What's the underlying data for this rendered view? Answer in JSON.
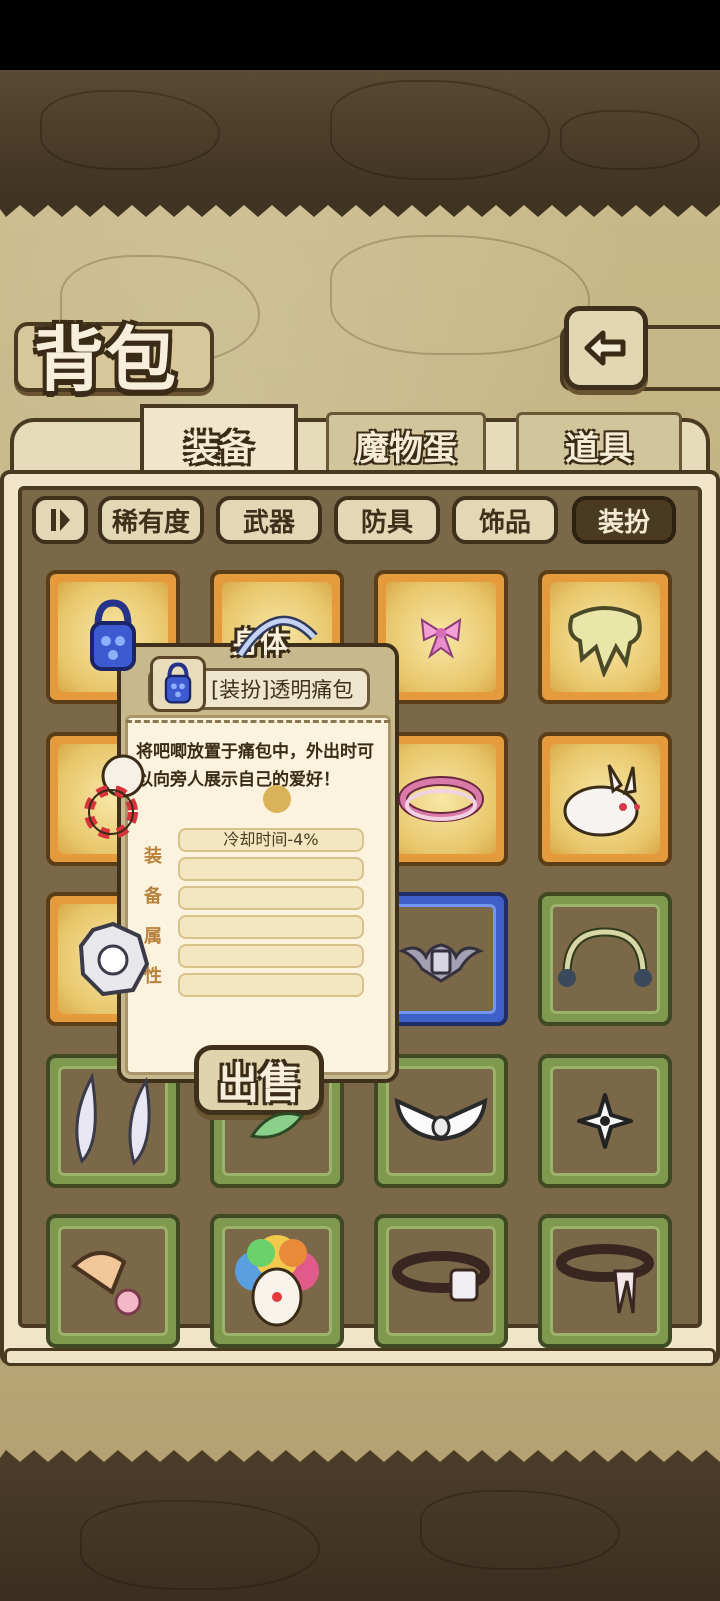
{
  "header": {
    "title": "背包",
    "back_icon": "return-arrow-icon"
  },
  "tabs": [
    {
      "label": "装备",
      "active": true
    },
    {
      "label": "魔物蛋",
      "active": false
    },
    {
      "label": "道具",
      "active": false
    }
  ],
  "filters": {
    "sort_icon": "sort-toggle-icon",
    "items": [
      "稀有度",
      "武器",
      "防具",
      "饰品",
      "装扮"
    ],
    "selected": "装扮"
  },
  "slots": [
    {
      "rarity": "gold",
      "icon": "blue-bag-icon"
    },
    {
      "rarity": "gold",
      "icon": "headband-icon"
    },
    {
      "rarity": "gold",
      "icon": "pink-bow-icon"
    },
    {
      "rarity": "gold",
      "icon": "yellow-slime-icon"
    },
    {
      "rarity": "gold",
      "icon": "candy-cane-icon"
    },
    {
      "rarity": "gold",
      "icon": "unknown-icon"
    },
    {
      "rarity": "gold",
      "icon": "bracelet-icon"
    },
    {
      "rarity": "gold",
      "icon": "white-rabbit-icon"
    },
    {
      "rarity": "gold",
      "icon": "bagua-mirror-icon"
    },
    {
      "rarity": "blue",
      "icon": "unknown-icon"
    },
    {
      "rarity": "blue",
      "icon": "bat-wing-emblem-icon"
    },
    {
      "rarity": "green",
      "icon": "headphones-icon"
    },
    {
      "rarity": "green",
      "icon": "feather-pair-icon"
    },
    {
      "rarity": "green",
      "icon": "green-leaf-icon"
    },
    {
      "rarity": "green",
      "icon": "white-bow-icon"
    },
    {
      "rarity": "green",
      "icon": "shuriken-icon"
    },
    {
      "rarity": "green",
      "icon": "flower-horn-icon"
    },
    {
      "rarity": "green",
      "icon": "clown-wig-icon"
    },
    {
      "rarity": "green",
      "icon": "collar-tag-icon"
    },
    {
      "rarity": "green",
      "icon": "bunny-collar-icon"
    }
  ],
  "tooltip": {
    "slot_label": "身体",
    "item_icon": "blue-bag-icon",
    "item_name": "[装扮]透明痛包",
    "description": "将吧唧放置于痛包中，外出时可以向旁人展示自己的爱好！",
    "attr_heading": [
      "装",
      "备",
      "属",
      "性"
    ],
    "attributes": [
      "冷却时间-4%",
      "",
      "",
      "",
      "",
      ""
    ],
    "sell_label": "出售"
  }
}
